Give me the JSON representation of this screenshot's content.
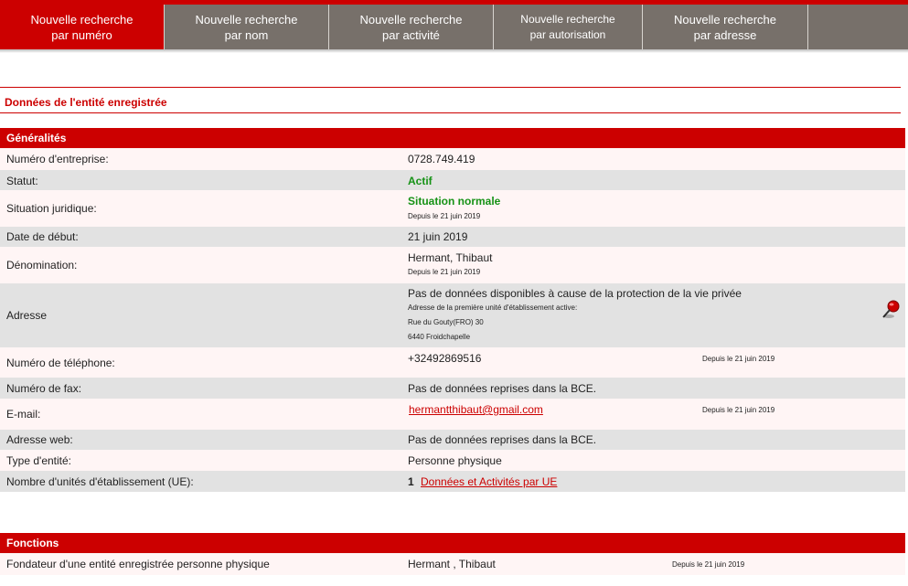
{
  "tabs": [
    {
      "label": "Nouvelle recherche\npar numéro",
      "active": true
    },
    {
      "label": "Nouvelle recherche\npar nom"
    },
    {
      "label": "Nouvelle recherche\npar activité"
    },
    {
      "label": "Nouvelle recherche\npar autorisation"
    },
    {
      "label": "Nouvelle recherche\npar adresse"
    },
    {
      "label": ""
    }
  ],
  "page_title": "Données de l'entité enregistrée",
  "generalites": {
    "title": "Généralités",
    "numero_label": "Numéro d'entreprise:",
    "numero_value": "0728.749.419",
    "statut_label": "Statut:",
    "statut_value": "Actif",
    "situation_label": "Situation juridique:",
    "situation_value": "Situation normale",
    "situation_since": "Depuis le 21 juin 2019",
    "date_label": "Date de début:",
    "date_value": "21 juin 2019",
    "denomination_label": "Dénomination:",
    "denomination_value": "Hermant, Thibaut",
    "denomination_since": "Depuis le 21 juin 2019",
    "adresse_label": "Adresse",
    "adresse_value": "Pas de données disponibles à cause de la protection de la vie privée",
    "adresse_note": "Adresse de la première unité d'établissement active:",
    "adresse_line1": "Rue du Gouty(FRO) 30",
    "adresse_line2": "6440 Froidchapelle",
    "tel_label": "Numéro de téléphone:",
    "tel_value": "+32492869516",
    "tel_since": "Depuis le 21 juin 2019",
    "fax_label": "Numéro de fax:",
    "fax_value": "Pas de données reprises dans la BCE.",
    "email_label": "E-mail:",
    "email_value": "hermantthibaut@gmail.com",
    "email_since": "Depuis le 21 juin 2019",
    "web_label": "Adresse web:",
    "web_value": "Pas de données reprises dans la BCE.",
    "type_label": "Type d'entité:",
    "type_value": "Personne physique",
    "ue_label": "Nombre d'unités d'établissement (UE):",
    "ue_count": "1",
    "ue_link": "Données et Activités par UE"
  },
  "fonctions": {
    "title": "Fonctions",
    "role": "Fondateur d'une entité enregistrée personne physique",
    "name": "Hermant ,  Thibaut",
    "since": "Depuis le 21 juin 2019"
  },
  "colors": {
    "accent": "#cc0000",
    "tab_bg": "#77706a",
    "status_green": "#169216"
  },
  "icons": {
    "map_pin": "map-pin-icon"
  }
}
